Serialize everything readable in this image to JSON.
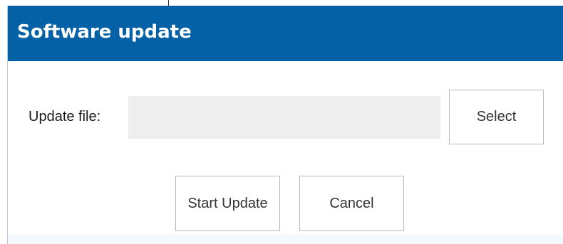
{
  "dialog": {
    "title": "Software update"
  },
  "form": {
    "update_file_label": "Update file:",
    "update_file_value": "",
    "select_label": "Select"
  },
  "actions": {
    "start_update_label": "Start Update",
    "cancel_label": "Cancel"
  },
  "colors": {
    "titlebar": "#0561a6",
    "field_background": "#eeeeee"
  }
}
